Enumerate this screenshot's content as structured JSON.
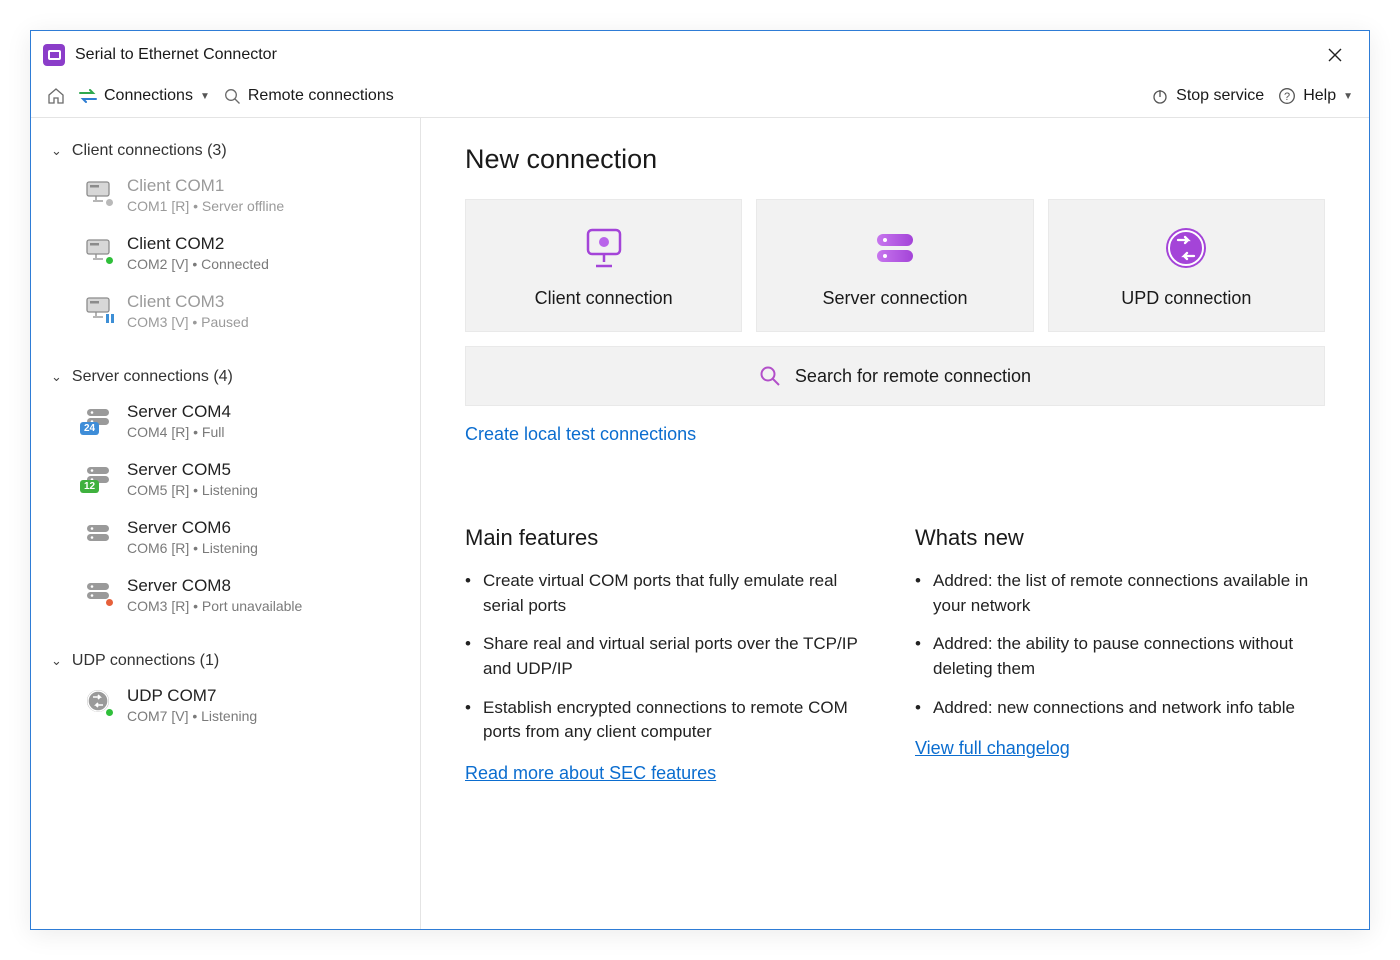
{
  "app": {
    "title": "Serial to Ethernet Connector"
  },
  "toolbar": {
    "connections": "Connections",
    "remote": "Remote connections",
    "stop": "Stop service",
    "help": "Help"
  },
  "sidebar": {
    "groups": [
      {
        "title": "Client connections (3)",
        "items": [
          {
            "name": "Client COM1",
            "sub": "COM1 [R] • Server offline",
            "iconType": "monitor",
            "inactive": true,
            "dot": "#b9b9b9"
          },
          {
            "name": "Client COM2",
            "sub": "COM2 [V] • Connected",
            "iconType": "monitor",
            "dot": "#2fbf3a"
          },
          {
            "name": "Client COM3",
            "sub": "COM3 [V] • Paused",
            "iconType": "monitor",
            "inactive": true,
            "pause": true
          }
        ]
      },
      {
        "title": "Server connections (4)",
        "items": [
          {
            "name": "Server COM4",
            "sub": "COM4 [R] • Full",
            "iconType": "server",
            "badge": "24",
            "badgeColor": "#3e8dd8"
          },
          {
            "name": "Server COM5",
            "sub": "COM5 [R] • Listening",
            "iconType": "server",
            "badge": "12",
            "badgeColor": "#3fb13e"
          },
          {
            "name": "Server COM6",
            "sub": "COM6 [R] • Listening",
            "iconType": "server"
          },
          {
            "name": "Server COM8",
            "sub": "COM3 [R] • Port unavailable",
            "iconType": "server",
            "dot": "#e6603a"
          }
        ]
      },
      {
        "title": "UDP connections (1)",
        "items": [
          {
            "name": "UDP COM7",
            "sub": "COM7 [V] • Listening",
            "iconType": "udp",
            "dot": "#2fbf3a"
          }
        ]
      }
    ]
  },
  "main": {
    "newConnection": "New connection",
    "cards": {
      "client": "Client connection",
      "server": "Server connection",
      "udp": "UPD connection"
    },
    "search": "Search for remote connection",
    "createLocal": "Create local test connections",
    "features": {
      "title": "Main features",
      "items": [
        "Create virtual COM ports that fully emulate real serial ports",
        "Share real and virtual serial ports over the TCP/IP and UDP/IP",
        "Establish encrypted connections to remote COM ports from any client computer"
      ],
      "link": "Read more about SEC features"
    },
    "whatsnew": {
      "title": "Whats new",
      "items": [
        "Addred: the list of remote connections available in your network",
        "Addred: the ability to pause connections without deleting them",
        "Addred: new connections and network info table"
      ],
      "link": "View full changelog"
    }
  }
}
